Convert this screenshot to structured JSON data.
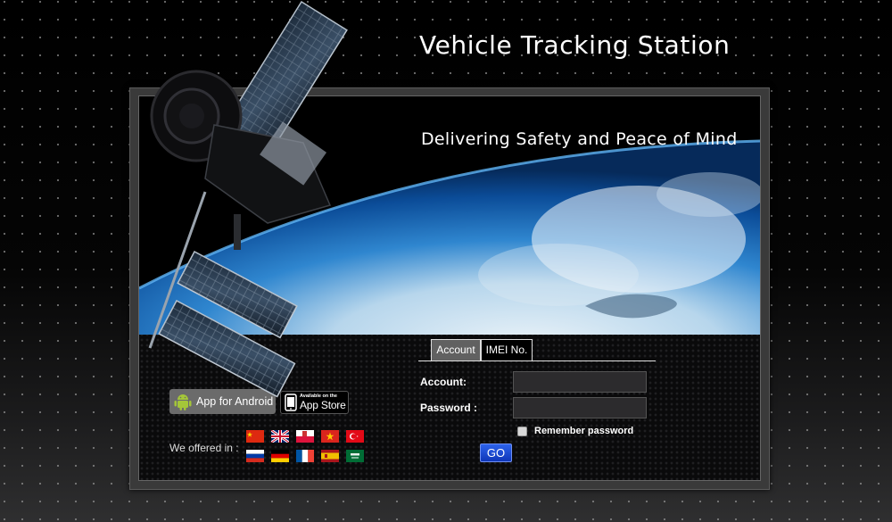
{
  "header": {
    "title": "Vehicle Tracking Station"
  },
  "banner": {
    "tagline": "Delivering Safety and Peace of Mind"
  },
  "login": {
    "tabs": [
      {
        "label": "Account",
        "active": true
      },
      {
        "label": "IMEI No.",
        "active": false
      }
    ],
    "account_label": "Account:",
    "account_value": "",
    "password_label": "Password :",
    "password_value": "",
    "remember_label": "Remember password",
    "remember_checked": false,
    "go_label": "GO"
  },
  "apps": {
    "android_label": "App for Android",
    "appstore_small": "Available on the",
    "appstore_big": "App Store"
  },
  "languages": {
    "label": "We offered in :",
    "flags": [
      "china",
      "united-kingdom",
      "poland",
      "vietnam",
      "turkey",
      "russia",
      "germany",
      "france",
      "spain",
      "saudi-arabia"
    ]
  },
  "colors": {
    "go_button": "#1f4fd6",
    "active_tab": "#616161",
    "android_button": "#6b6b6b",
    "input_bg": "#2c2b2d"
  }
}
